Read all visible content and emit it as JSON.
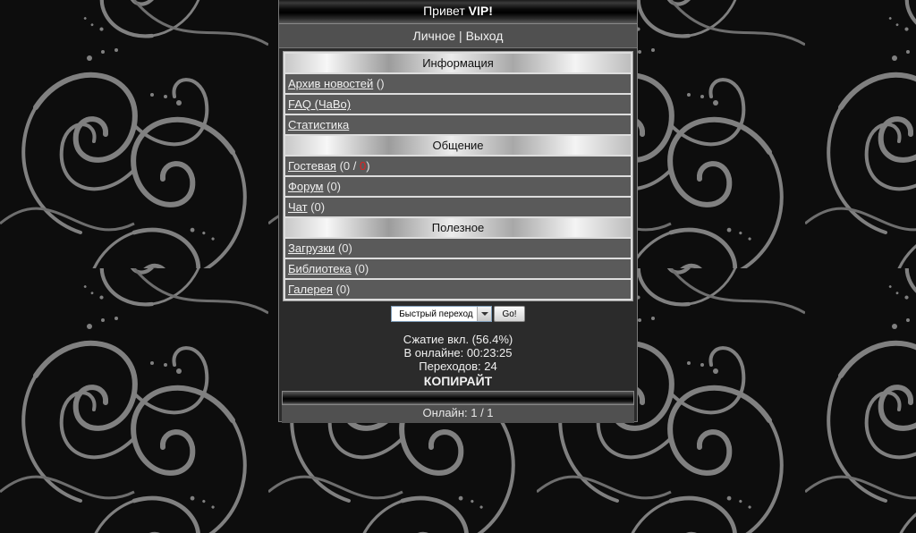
{
  "header": {
    "greeting": "Привет",
    "username": "VIP!"
  },
  "user_links": {
    "personal": "Личное",
    "separator": " | ",
    "logout": "Выход"
  },
  "sections": [
    {
      "title": "Информация",
      "items": [
        {
          "label": "Архив новостей",
          "count": "()"
        },
        {
          "label": "FAQ (ЧаВо)",
          "count": ""
        },
        {
          "label": "Статистика",
          "count": ""
        }
      ]
    },
    {
      "title": "Общение",
      "items": [
        {
          "label": "Гостевая",
          "count_prefix": "(0 / ",
          "count_new": "0",
          "count_suffix": ")"
        },
        {
          "label": "Форум",
          "count": "(0)"
        },
        {
          "label": "Чат",
          "count": "(0)"
        }
      ]
    },
    {
      "title": "Полезное",
      "items": [
        {
          "label": "Загрузки",
          "count": "(0)"
        },
        {
          "label": "Библиотека",
          "count": "(0)"
        },
        {
          "label": "Галерея",
          "count": "(0)"
        }
      ]
    }
  ],
  "quick_nav": {
    "selected": "Быстрый переход",
    "go_label": "Go!"
  },
  "stats": {
    "compression": "Сжатие вкл. (56.4%)",
    "online_time": "В онлайне: 00:23:25",
    "transitions": "Переходов: 24",
    "copyright": "КОПИРАЙТ"
  },
  "footer": {
    "online": "Онлайн: 1 / 1"
  },
  "colors": {
    "accent_red": "#e02020",
    "panel": "#2b2b2b",
    "row": "#5a5a5a"
  }
}
